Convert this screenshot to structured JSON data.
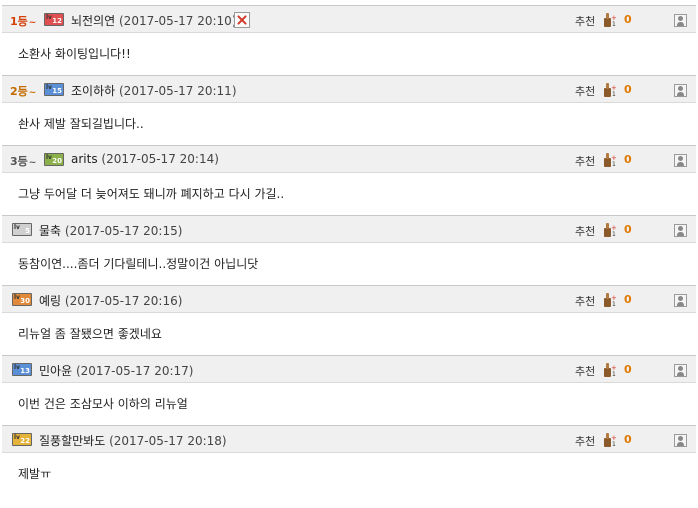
{
  "recommend_label": "추천",
  "comments": [
    {
      "rank": "1",
      "rank_unit": "등",
      "rank_color": "#d4400a",
      "level": "12",
      "level_color": "#e05050",
      "author": "뇌전의연",
      "date": "(2017-05-17 20:10)",
      "recommend_count": "0",
      "text": "소환사 화이팅입니다!!",
      "has_delete": true
    },
    {
      "rank": "2",
      "rank_unit": "등",
      "rank_color": "#c26a00",
      "level": "15",
      "level_color": "#5b8fd6",
      "author": "조이하하",
      "date": "(2017-05-17 20:11)",
      "recommend_count": "0",
      "text": "솬사 제발 잘되길빕니다..",
      "has_delete": false
    },
    {
      "rank": "3",
      "rank_unit": "등",
      "rank_color": "#555555",
      "level": "20",
      "level_color": "#8cb04a",
      "author": "arits",
      "date": "(2017-05-17 20:14)",
      "recommend_count": "0",
      "text": "그냥 두어달 더 늦어져도 돼니까 폐지하고 다시 가길..",
      "has_delete": false
    },
    {
      "rank": "",
      "rank_unit": "",
      "rank_color": "",
      "level": "5",
      "level_color": "#cfcfcf",
      "author": "물축",
      "date": "(2017-05-17 20:15)",
      "recommend_count": "0",
      "text": "동참이연....좀더 기다릴테니..정말이건 아닙니닷",
      "has_delete": false
    },
    {
      "rank": "",
      "rank_unit": "",
      "rank_color": "",
      "level": "30",
      "level_color": "#e08a3a",
      "author": "예링",
      "date": "(2017-05-17 20:16)",
      "recommend_count": "0",
      "text": "리뉴얼 좀 잘됐으면 좋겠네요",
      "has_delete": false
    },
    {
      "rank": "",
      "rank_unit": "",
      "rank_color": "",
      "level": "13",
      "level_color": "#5b8fd6",
      "author": "민아윤",
      "date": "(2017-05-17 20:17)",
      "recommend_count": "0",
      "text": "이번 건은 조삼모사 이하의 리뉴얼",
      "has_delete": false
    },
    {
      "rank": "",
      "rank_unit": "",
      "rank_color": "",
      "level": "22",
      "level_color": "#e5b23a",
      "author": "질풍할만봐도",
      "date": "(2017-05-17 20:18)",
      "recommend_count": "0",
      "text": "제발ㅠ",
      "has_delete": false
    }
  ]
}
